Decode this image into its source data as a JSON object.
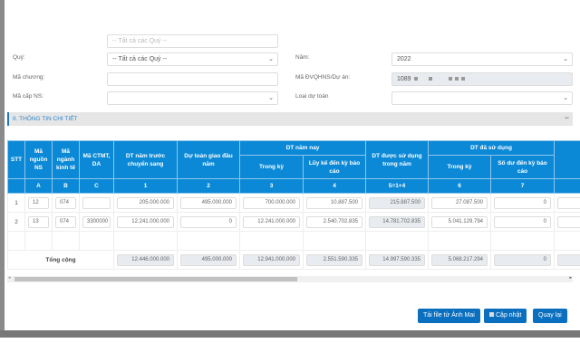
{
  "form": {
    "top_partial_value": "-- Tất cả các Quý --",
    "quy_label": "Quý:",
    "quy_value": "-- Tất cả các Quý --",
    "nam_label": "Năm:",
    "nam_value": "2022",
    "ma_chuong_label": "Mã chương:",
    "ma_chuong_value": "",
    "ma_dv_label": "Mã ĐVQHNS/Dự án:",
    "ma_dv_value": "1089",
    "ma_cap_label": "Mã cấp NS:",
    "ma_cap_value": "",
    "loai_label": "Loại dự toán",
    "loai_value": ""
  },
  "section": {
    "title": "II. THÔNG TIN CHI TIẾT",
    "collapse": "−"
  },
  "table": {
    "h_stt": "STT",
    "h_a": "Mã nguồn NS",
    "h_b": "Mã ngành kinh tế",
    "h_c": "Mã CTMT, DA",
    "h_1": "DT năm trước chuyển sang",
    "h_2": "Dự toán giao đầu năm",
    "h_group1": "DT năm nay",
    "h_3": "Trong kỳ",
    "h_4": "Lũy kế đến kỳ báo cáo",
    "h_5": "DT được sử dụng trong năm",
    "h_group2": "DT đã sử dụng",
    "h_6": "Trong kỳ",
    "h_7": "Số dư đến kỳ báo cáo",
    "codes": [
      "A",
      "B",
      "C",
      "1",
      "2",
      "3",
      "4",
      "5=1+4",
      "6",
      "7"
    ],
    "rows": [
      {
        "stt": "1",
        "a": "12",
        "b": "074",
        "c": "",
        "v1": "205.000.000",
        "v2": "495.000.000",
        "v3": "700.000.000",
        "v4": "10.887.500",
        "v5": "215.887.500",
        "v6": "27.087.500",
        "v7": "0"
      },
      {
        "stt": "2",
        "a": "13",
        "b": "074",
        "c": "3300000",
        "v1": "12.241.000.000",
        "v2": "0",
        "v3": "12.241.000.000",
        "v4": "2.540.702.835",
        "v5": "14.781.702.835",
        "v6": "5.041.129.794",
        "v7": "0"
      }
    ],
    "total": {
      "label": "Tổng cộng",
      "v1": "12.446.000.000",
      "v2": "495.000.000",
      "v3": "12.941.000.000",
      "v4": "2.551.590.335",
      "v5": "14.997.590.335",
      "v6": "5.068.217.294",
      "v7": "0"
    }
  },
  "buttons": {
    "upload": "Tải file từ Ảnh Mai",
    "update": "Cập nhật",
    "back": "Quay lại"
  },
  "colors": {
    "header": "#0b89d6",
    "button": "#0b6fc0"
  }
}
